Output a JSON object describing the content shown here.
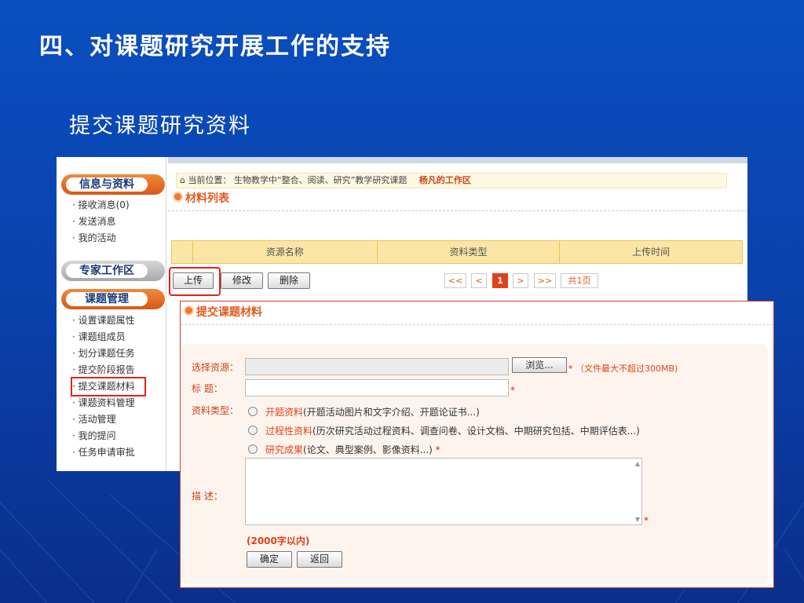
{
  "slide": {
    "title": "四、对课题研究开展工作的支持",
    "subtitle": "提交课题研究资料"
  },
  "sidebar": {
    "group1": {
      "title": "信息与资料",
      "items": [
        "· 接收消息(0)",
        "· 发送消息",
        "· 我的活动"
      ]
    },
    "group2": {
      "title": "专家工作区"
    },
    "group3": {
      "title": "课题管理",
      "items": [
        "· 设置课题属性",
        "· 课题组成员",
        "· 划分课题任务",
        "· 提交阶段报告",
        "· 提交课题材料",
        "· 课题资料管理",
        "· 活动管理",
        "· 我的提问",
        "· 任务申请审批"
      ],
      "active_index": 4
    }
  },
  "breadcrumb": {
    "prefix": "当前位置：",
    "path": "生物教学中“整合、阅读、研究”教学研究课题",
    "current": "杨凡的工作区"
  },
  "materials": {
    "title": "材料列表",
    "columns": [
      "资源名称",
      "资料类型",
      "上传时间"
    ],
    "buttons": {
      "upload": "上传",
      "edit": "修改",
      "delete": "删除"
    },
    "pager": {
      "first": "<<",
      "prev": "<",
      "page": "1",
      "next": ">",
      "last": ">>",
      "total": "共1页"
    }
  },
  "submit_form": {
    "title": "提交课题材料",
    "resource_label": "选择资源：",
    "browse_label": "浏览...",
    "file_hint": "（文件最大不超过300MB)",
    "title_label": "标    题：",
    "type_label": "资料类型：",
    "types": [
      {
        "name": "开题资料",
        "desc": "(开题活动图片和文字介绍、开题论证书...)"
      },
      {
        "name": "过程性资料",
        "desc": "(历次研究活动过程资料、调查问卷、设计文档、中期研究包括、中期评估表...)"
      },
      {
        "name": "研究成果",
        "desc": "(论文、典型案例、影像资料...)"
      }
    ],
    "desc_label": "描    述：",
    "limit": "(2000字以内)",
    "ok": "确定",
    "back": "返回",
    "required_mark": "*"
  }
}
